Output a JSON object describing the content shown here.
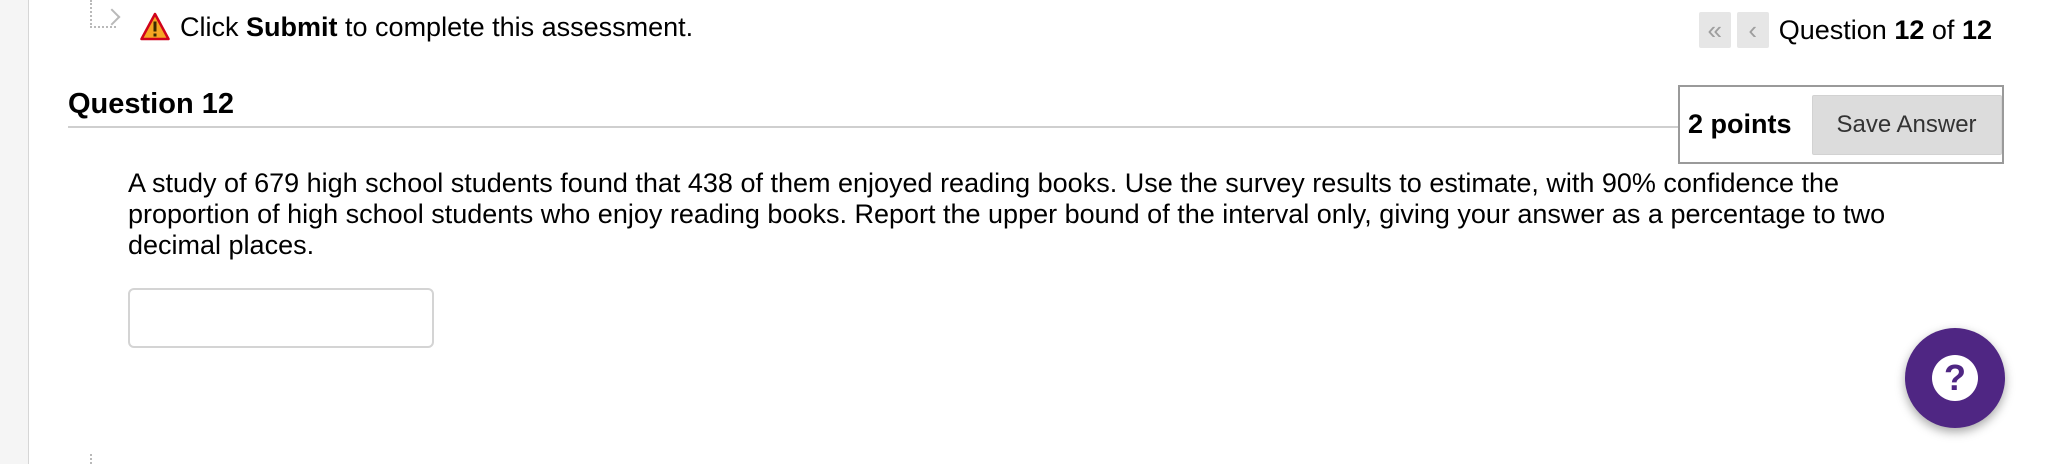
{
  "notice": {
    "prefix": "Click",
    "emphasis": "Submit",
    "suffix": "to complete this assessment.",
    "icon": "warning-icon"
  },
  "question_nav": {
    "first_icon": "double-chevron-left-icon",
    "prev_icon": "chevron-left-icon",
    "label": "Question",
    "current": "12",
    "of_word": "of",
    "total": "12"
  },
  "question": {
    "title": "Question 12",
    "points": "2 points",
    "save_label": "Save Answer",
    "text": "A study of 679 high school students found that 438 of them enjoyed reading books. Use the survey results to estimate, with 90% confidence the proportion of high school students who enjoy reading books. Report the upper bound of the interval only, giving your answer as a percentage to two decimal places.",
    "answer_value": ""
  },
  "help": {
    "icon": "question-mark-icon"
  },
  "colors": {
    "help_button": "#4f2683",
    "warning_fill": "#f6a623",
    "warning_stroke": "#d0021b"
  }
}
